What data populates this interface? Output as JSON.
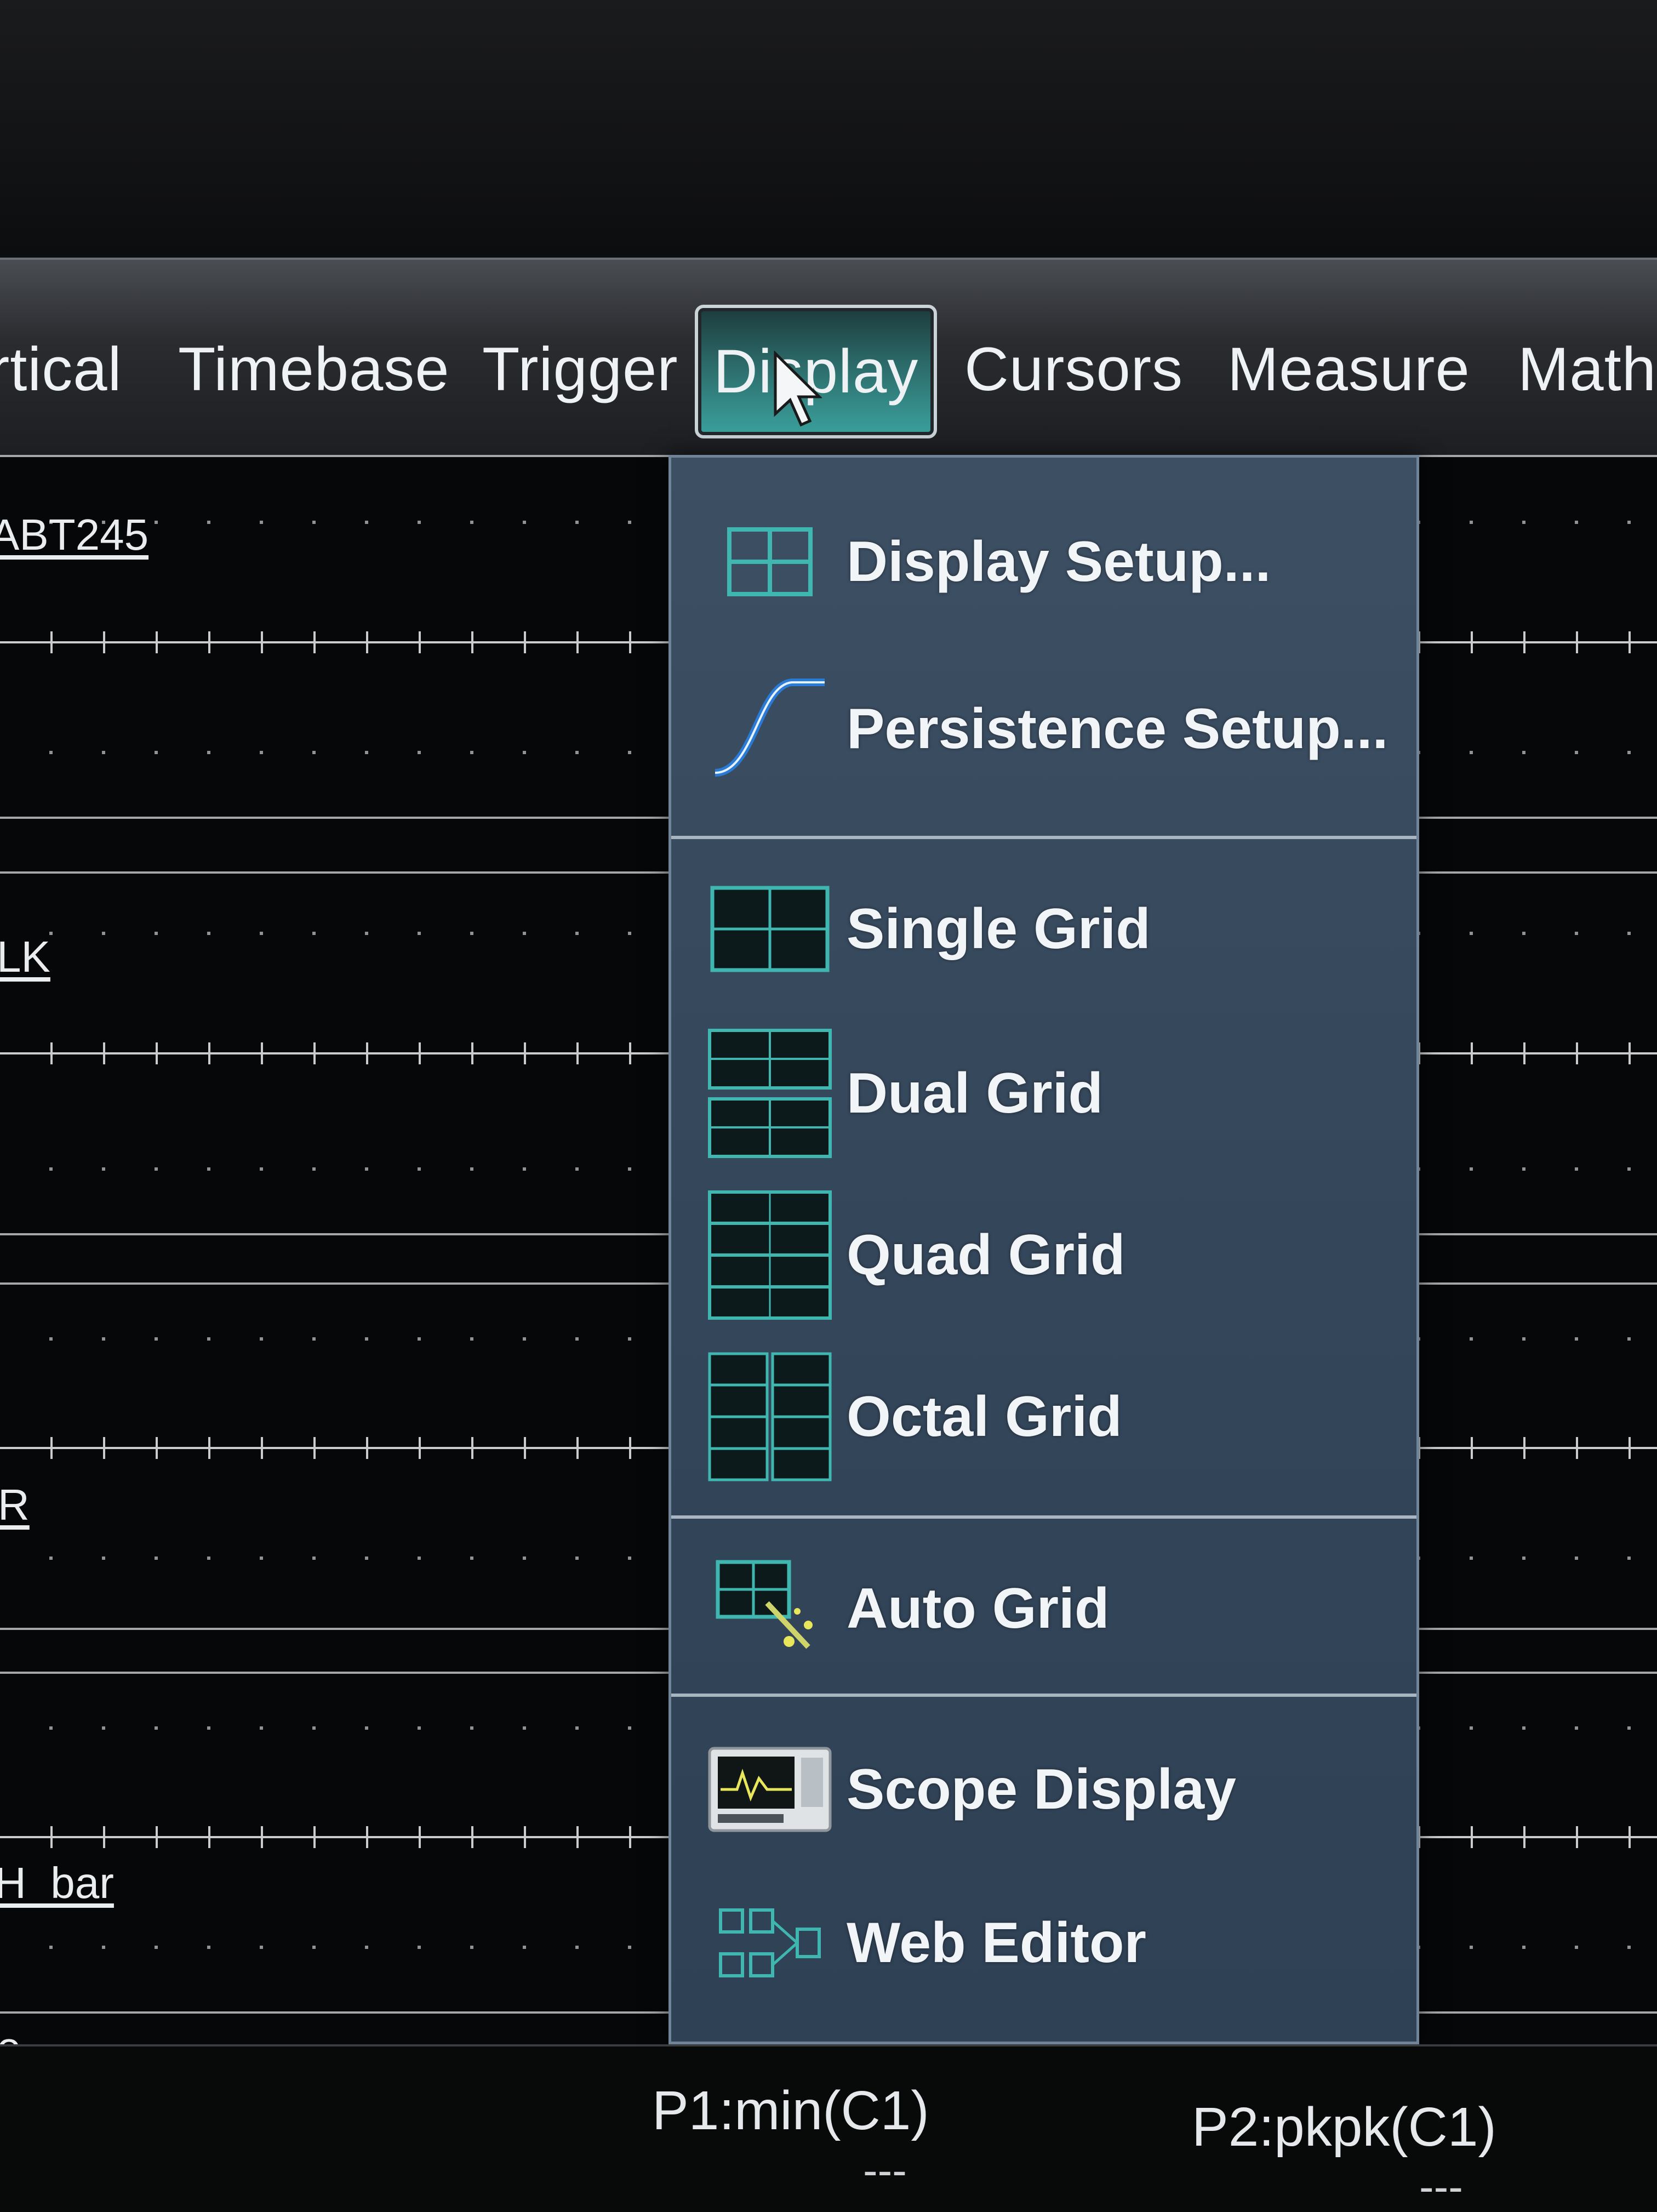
{
  "menubar": {
    "items": [
      {
        "label": "rtical"
      },
      {
        "label": "Timebase"
      },
      {
        "label": "Trigger"
      },
      {
        "label": "Display",
        "active": true
      },
      {
        "label": "Cursors"
      },
      {
        "label": "Measure"
      },
      {
        "label": "Math"
      }
    ]
  },
  "traces": {
    "labels": [
      "ABT245",
      "LK",
      "R",
      "H_bar",
      "e"
    ]
  },
  "display_menu": {
    "items": [
      {
        "label": "Display Setup...",
        "icon": "grid-four-icon"
      },
      {
        "label": "Persistence Setup...",
        "icon": "persistence-curve-icon"
      },
      {
        "label": "Single Grid",
        "icon": "single-grid-icon"
      },
      {
        "label": "Dual Grid",
        "icon": "dual-grid-icon"
      },
      {
        "label": "Quad Grid",
        "icon": "quad-grid-icon"
      },
      {
        "label": "Octal Grid",
        "icon": "octal-grid-icon"
      },
      {
        "label": "Auto Grid",
        "icon": "auto-grid-icon"
      },
      {
        "label": "Scope Display",
        "icon": "scope-display-icon"
      },
      {
        "label": "Web Editor",
        "icon": "web-editor-icon"
      }
    ]
  },
  "parameters": {
    "p1": {
      "label": "P1:min(C1)",
      "value": "---"
    },
    "p2": {
      "label": "P2:pkpk(C1)",
      "value": "---"
    }
  },
  "colors": {
    "menu_bg": "#34465a",
    "active_tab": "#3ba19d",
    "icon_teal": "#3fb7b0",
    "icon_blue": "#2a7bd6"
  }
}
